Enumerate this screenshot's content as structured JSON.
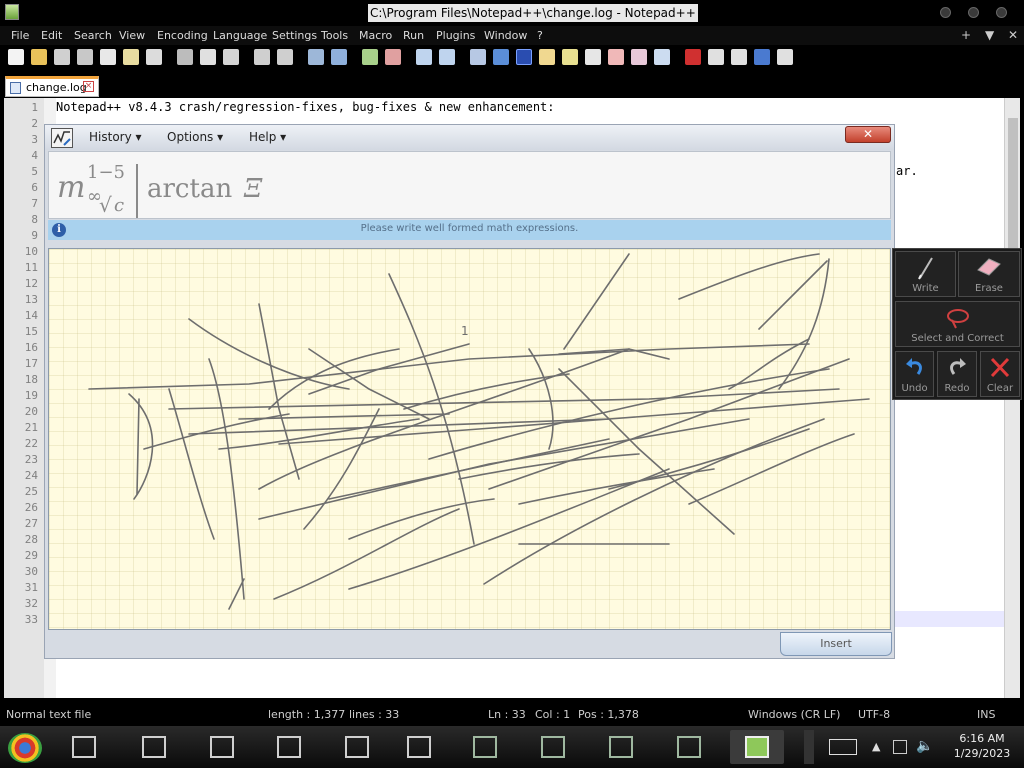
{
  "window": {
    "title": "C:\\Program Files\\Notepad++\\change.log - Notepad++"
  },
  "menu": {
    "items": [
      "File",
      "Edit",
      "Search",
      "View",
      "Encoding",
      "Language",
      "Settings",
      "Tools",
      "Macro",
      "Run",
      "Plugins",
      "Window",
      "?"
    ],
    "right": [
      "+",
      "▼",
      "✕"
    ]
  },
  "tab": {
    "label": "change.log"
  },
  "editor": {
    "line_numbers": [
      "1",
      "2",
      "3",
      "4",
      "5",
      "6",
      "7",
      "8",
      "9",
      "10",
      "11",
      "12",
      "13",
      "14",
      "15",
      "16",
      "17",
      "18",
      "19",
      "20",
      "21",
      "22",
      "23",
      "24",
      "25",
      "26",
      "27",
      "28",
      "29",
      "30",
      "31",
      "32",
      "33"
    ],
    "line1": "Notepad++ v8.4.3 crash/regression-fixes, bug-fixes & new enhancement:",
    "line5_tail": "ar."
  },
  "math_panel": {
    "menus": [
      "History",
      "Options",
      "Help"
    ],
    "close_label": "✕",
    "formula": {
      "base": "m",
      "sup": "1−5",
      "sub_inf": "∞",
      "radical": "√",
      "radicand": "c",
      "func": "arctan",
      "var": "Ξ"
    },
    "info_icon": "i",
    "info_text": "Please write well formed math expressions.",
    "stroke_label": "1",
    "insert_label": "Insert"
  },
  "tools": {
    "write": "Write",
    "erase": "Erase",
    "select_correct": "Select and Correct",
    "undo": "Undo",
    "redo": "Redo",
    "clear": "Clear"
  },
  "status": {
    "file_type": "Normal text file",
    "length": "length : 1,377",
    "lines": "lines : 33",
    "ln": "Ln : 33",
    "col": "Col : 1",
    "pos": "Pos : 1,378",
    "eol": "Windows (CR LF)",
    "encoding": "UTF-8",
    "mode": "INS"
  },
  "taskbar": {
    "time": "6:16 AM",
    "date": "1/29/2023"
  },
  "colors": {
    "accent_tab": "#f2a43c",
    "canvas_bg": "#fffbe0",
    "info_bar": "#a9d2ee",
    "ink": "#6e6e6e"
  }
}
